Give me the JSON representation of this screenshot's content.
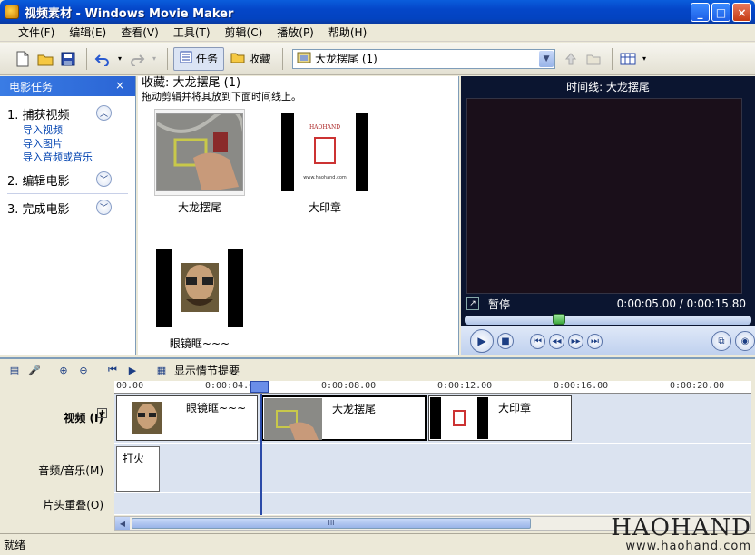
{
  "window": {
    "title": "视频素材 - Windows Movie Maker",
    "min": "_",
    "max": "□",
    "close": "×"
  },
  "menu": [
    "文件(F)",
    "编辑(E)",
    "查看(V)",
    "工具(T)",
    "剪辑(C)",
    "播放(P)",
    "帮助(H)"
  ],
  "toolbar": {
    "tasks_label": "任务",
    "collections_label": "收藏",
    "collection_value": "大龙摆尾 (1)"
  },
  "taskpane": {
    "header": "电影任务",
    "close": "×",
    "sections": [
      {
        "label": "1. 捕获视频",
        "links": [
          "导入视频",
          "导入图片",
          "导入音频或音乐"
        ],
        "state": "expanded"
      },
      {
        "label": "2. 编辑电影",
        "links": [],
        "state": "collapsed"
      },
      {
        "label": "3. 完成电影",
        "links": [],
        "state": "collapsed"
      }
    ]
  },
  "collection": {
    "title": "收藏: 大龙摆尾 (1)",
    "subtitle": "拖动剪辑并将其放到下面时间线上。",
    "clips": [
      {
        "label": "大龙摆尾"
      },
      {
        "label": "大印章"
      },
      {
        "label": "眼镜眶~~~"
      }
    ],
    "stamp_text": "HAOHAND",
    "stamp_url": "www.haohand.com"
  },
  "monitor": {
    "title": "时间线: 大龙摆尾",
    "status": "暂停",
    "time": "0:00:05.00 / 0:00:15.80",
    "progress": 0.32
  },
  "timeline": {
    "toolbar_label": "显示情节提要",
    "ruler": [
      "00.00",
      "0:00:04.00",
      "0:00:08.00",
      "0:00:12.00",
      "0:00:16.00",
      "0:00:20.00"
    ],
    "tracks": {
      "video": "视频 (I)",
      "video_expand": "+",
      "audio": "音频/音乐(M)",
      "title_overlay": "片头重叠(O)"
    },
    "video_clips": [
      {
        "label": "眼镜眶~~~"
      },
      {
        "label": "大龙摆尾"
      },
      {
        "label": "大印章"
      }
    ],
    "audio_clips": [
      {
        "label": "打火"
      }
    ],
    "scroll_grip": "III"
  },
  "status": "就绪",
  "watermark": {
    "brand": "HAOHAND",
    "url": "www.haohand.com"
  }
}
